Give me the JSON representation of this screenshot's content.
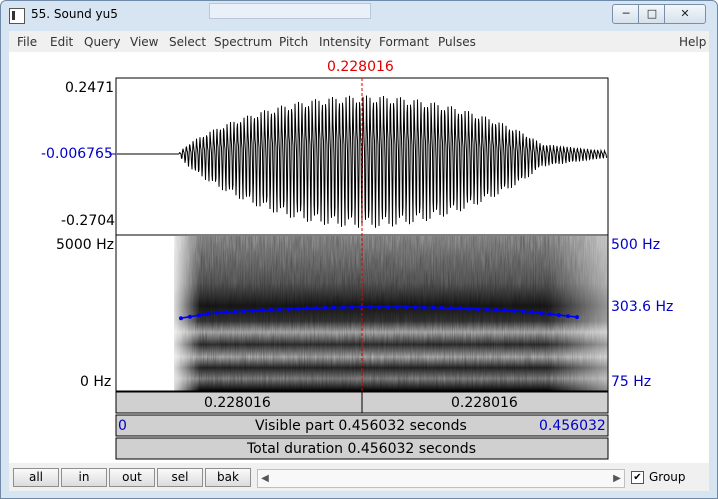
{
  "window": {
    "title": "55. Sound yu5",
    "min_glyph": "─",
    "max_glyph": "□",
    "close_glyph": "✕"
  },
  "menu": [
    "File",
    "Edit",
    "Query",
    "View",
    "Select",
    "Spectrum",
    "Pitch",
    "Intensity",
    "Formant",
    "Pulses"
  ],
  "help": "Help",
  "cursor": {
    "time": "0.228016",
    "time_left": "0.228016",
    "time_right": "0.228016"
  },
  "waveform": {
    "max": "0.2471",
    "cursor_value": "-0.006765",
    "min": "-0.2704"
  },
  "spectrogram": {
    "top_freq": "5000 Hz",
    "bottom_freq": "0 Hz"
  },
  "pitch": {
    "top": "500 Hz",
    "current": "303.6 Hz",
    "bottom": "75 Hz"
  },
  "info": {
    "visible_start": "0",
    "visible_part": "Visible part 0.456032 seconds",
    "visible_end": "0.456032",
    "total_duration": "Total duration 0.456032 seconds"
  },
  "buttons": {
    "all": "all",
    "in": "in",
    "out": "out",
    "sel": "sel",
    "bak": "bak"
  },
  "scroll": {
    "left_arrow": "◀",
    "right_arrow": "▶"
  },
  "group": {
    "label": "Group",
    "checked": "✔"
  },
  "colors": {
    "cursor": "#e00000",
    "blue_labels": "#0000c8",
    "pitch_curve": "#0000ff"
  }
}
